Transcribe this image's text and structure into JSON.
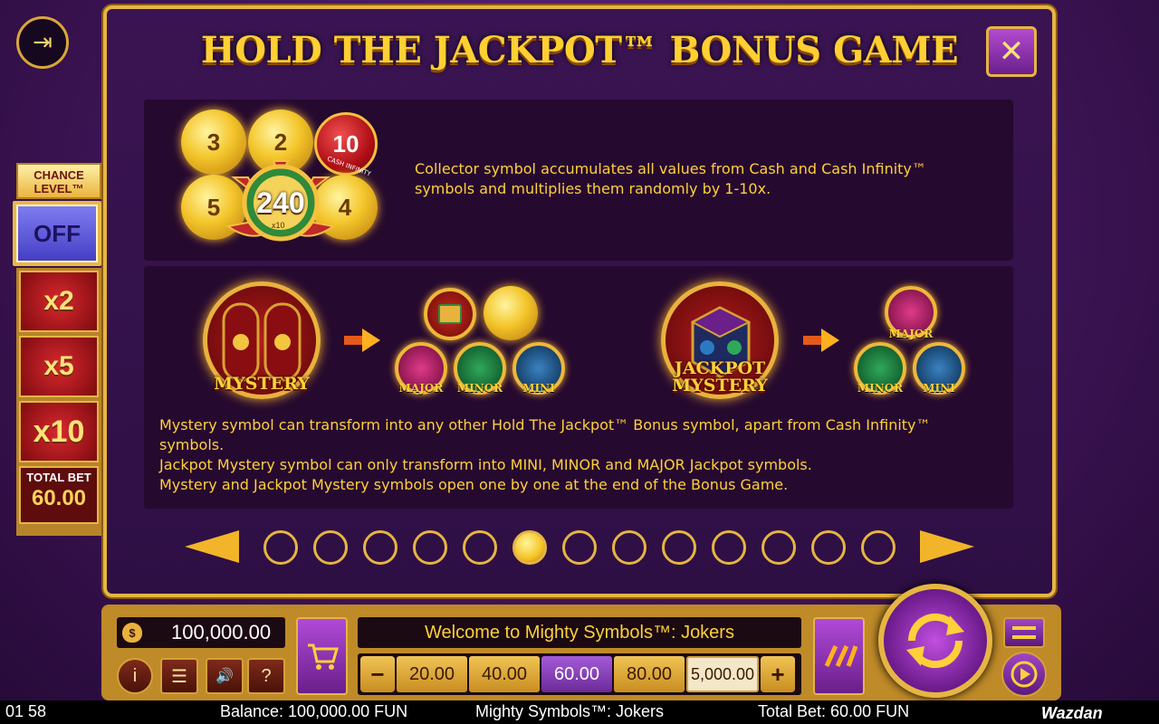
{
  "title": "HOLD THE JACKPOT™ BONUS GAME",
  "close_glyph": "✕",
  "exit_glyph": "⇥",
  "chance_level": {
    "label": "CHANCE LEVEL™",
    "off": "OFF",
    "multipliers": [
      "x2",
      "x5",
      "x10"
    ],
    "total_bet_label": "TOTAL BET",
    "total_bet_value": "60.00"
  },
  "collector": {
    "coins": [
      "3",
      "2",
      "10",
      "5",
      "240",
      "4"
    ],
    "ribbon": "CASH INFINITY",
    "multiplier": "x10",
    "description": "Collector symbol accumulates all values from Cash and Cash Infinity™ symbols and multiplies them randomly by 1-10x."
  },
  "mystery": {
    "symbol_label": "MYSTERY",
    "jackpot_symbol_label": "JACKPOT MYSTERY",
    "gems": {
      "major": "MAJOR",
      "minor": "MINOR",
      "mini": "MINI"
    },
    "lines": [
      "Mystery symbol can transform into any other Hold The Jackpot™ Bonus symbol, apart from Cash Infinity™ symbols.",
      "Jackpot Mystery symbol can only transform into MINI, MINOR and MAJOR Jackpot symbols.",
      "Mystery and Jackpot Mystery symbols open one by one at the end of the Bonus Game."
    ]
  },
  "pagination": {
    "total": 13,
    "active": 6
  },
  "bottom_bar": {
    "balance": "100,000.00",
    "money_bag_icon": "money-bag",
    "message": "Welcome to Mighty Symbols™: Jokers",
    "bets": [
      "20.00",
      "40.00",
      "60.00",
      "80.00",
      "5,000.00"
    ],
    "selected_bet": "60.00",
    "minus": "−",
    "plus": "+",
    "info": "i",
    "menu": "☰",
    "sound": "🔊",
    "help": "?"
  },
  "status": {
    "time": "01 58",
    "balance": "Balance: 100,000.00 FUN",
    "game": "Mighty Symbols™: Jokers",
    "total_bet": "Total Bet: 60.00 FUN",
    "brand": "Wazdan"
  },
  "colors": {
    "gold": "#e6b543",
    "panel": "#2e0f44",
    "text_gold": "#ffd03a",
    "mini": "#1f5c8a",
    "minor": "#1a7a3a",
    "major": "#a0145a"
  }
}
